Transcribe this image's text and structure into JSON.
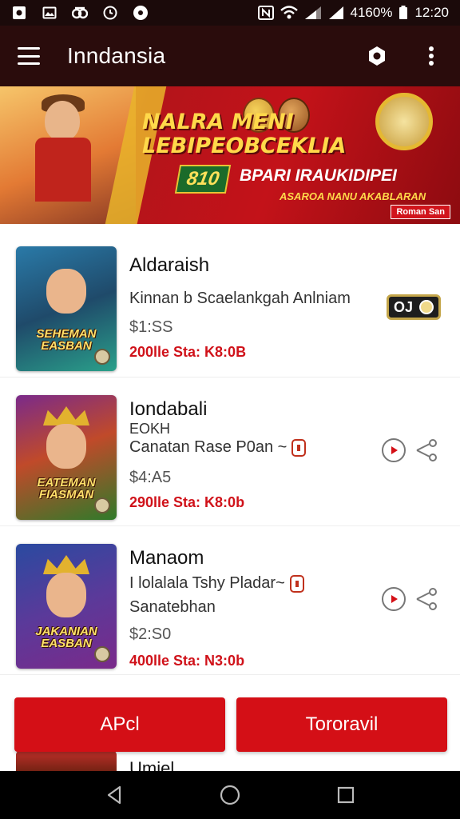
{
  "status_bar": {
    "battery": "4160%",
    "time": "12:20"
  },
  "app_bar": {
    "title": "Inndansia",
    "icons": [
      "menu-icon",
      "settings-icon",
      "more-vert-icon"
    ]
  },
  "banner": {
    "headline": "NALRA MENI LEBIPEOBCEKLIA",
    "price_badge": "810",
    "subline": "BPARI IRAUKIDIPEI",
    "subline2": "ASAROA NANU AKABLARAN",
    "tag": "Roman San"
  },
  "items": [
    {
      "title": "Aldaraish",
      "line1": "Kinnan b Scaelankgah Anlniam",
      "price": "$1:SS",
      "sale": "200lle Sta: K8:0B",
      "thumb_caption": "SEHEMAN EASBAN",
      "thumb_colors": [
        "#1f6b8a",
        "#2aa08a"
      ]
    },
    {
      "title": "Iondabali",
      "subtitle": "EOKH",
      "line1": "Canatan Rase P0an ~",
      "price": "$4:A5",
      "sale": "290lle Sta: K8:0b",
      "thumb_caption": "EATEMAN FIASMAN",
      "thumb_colors": [
        "#7a2a8a",
        "#2f7a2a"
      ]
    },
    {
      "title": "Manaom",
      "line1": "I lolalala Tshy Pladar~",
      "line2": "Sanatebhan",
      "price": "$2:S0",
      "sale": "400lle Sta: N3:0b",
      "thumb_caption": "JAKANIAN EASBAN",
      "thumb_colors": [
        "#2a4aa0",
        "#7a2a8a"
      ]
    }
  ],
  "item1_chip": "OJ",
  "buttons": {
    "left": "APcl",
    "right": "Tororavil"
  },
  "peek_title": "Umiel",
  "colors": {
    "accent": "#d40f16",
    "app_bar": "#2a0c0c"
  }
}
